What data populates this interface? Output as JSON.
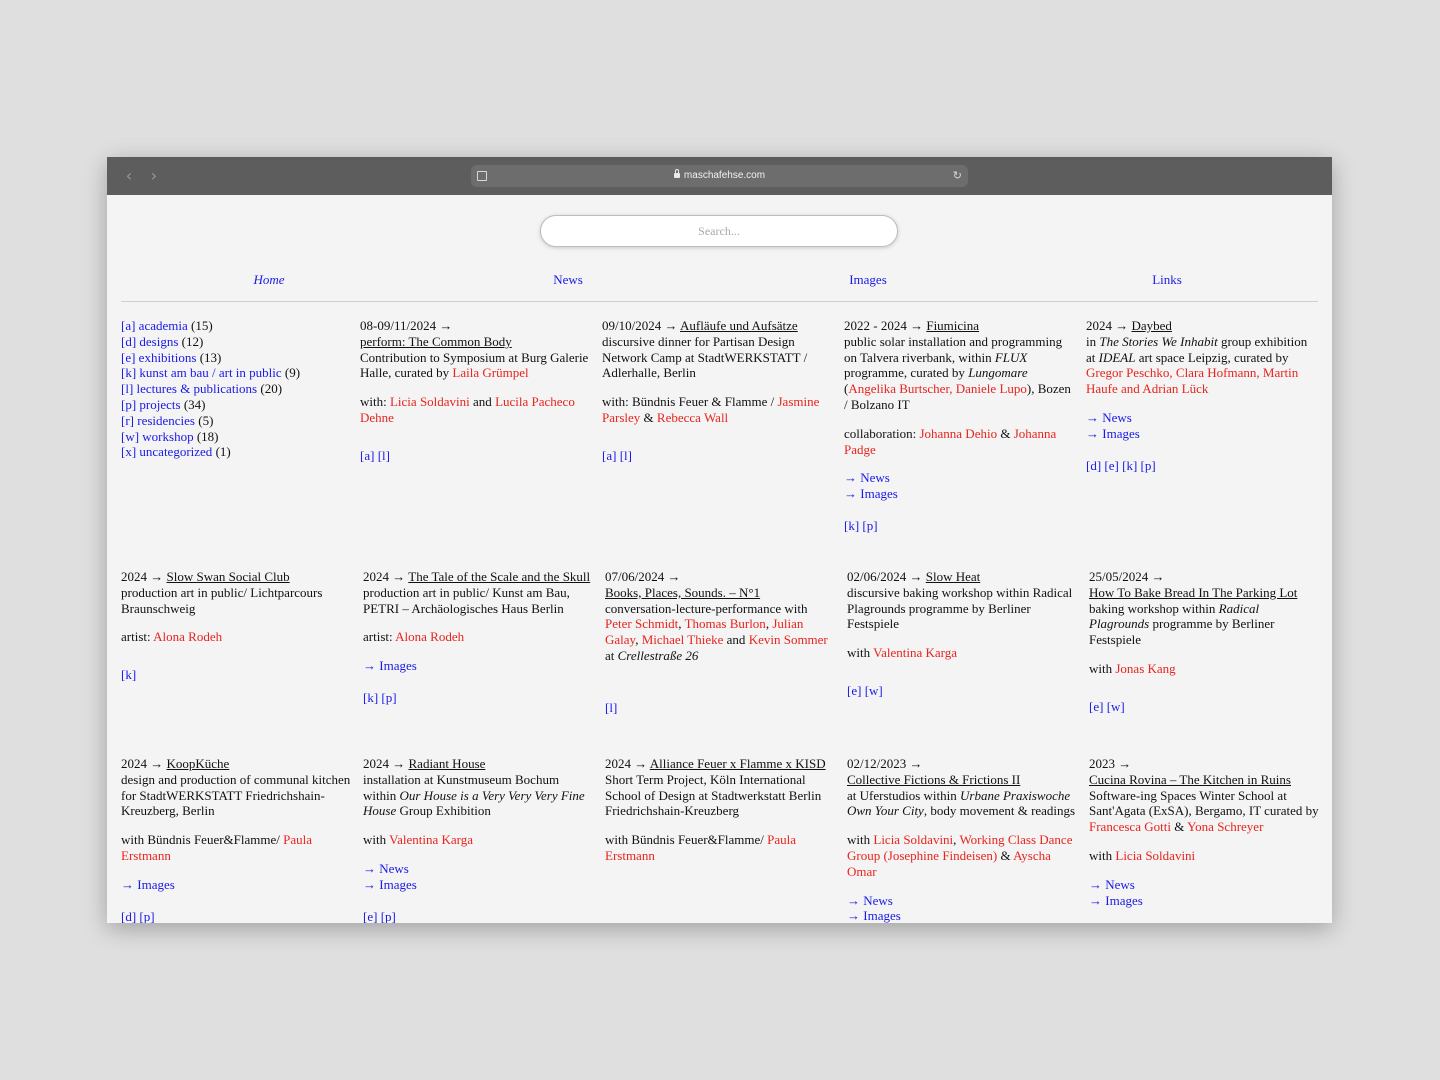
{
  "browser": {
    "url": "maschafehse.com",
    "back_icon": "‹",
    "forward_icon": "›"
  },
  "search": {
    "placeholder": "Search..."
  },
  "nav": {
    "home": "Home",
    "news": "News",
    "images": "Images",
    "links": "Links"
  },
  "categories": [
    {
      "label": "[a] academia",
      "count": "(15)"
    },
    {
      "label": "[d] designs",
      "count": "(12)"
    },
    {
      "label": "[e] exhibitions",
      "count": "(13)"
    },
    {
      "label": "[k] kunst am bau / art in public",
      "count": "(9)"
    },
    {
      "label": "[l] lectures & publications",
      "count": "(20)"
    },
    {
      "label": "[p] projects",
      "count": "(34)"
    },
    {
      "label": "[r] residencies",
      "count": "(5)"
    },
    {
      "label": "[w] workshop",
      "count": "(18)"
    },
    {
      "label": "[x] uncategorized",
      "count": "(1)"
    }
  ],
  "entries": {
    "e1": {
      "date": "08-09/11/2024 →",
      "title": "perform: The Common Body",
      "desc": "Contribution to Symposium at Burg Galerie Halle, curated by ",
      "curator": "Laila Grümpel",
      "with": "with: ",
      "p1": "Licia Soldavini",
      "and": " and ",
      "p2": "Lucila Pacheco Dehne",
      "tags": [
        "[a]",
        "[l]"
      ]
    },
    "e2": {
      "date": "09/10/2024 → ",
      "title": "Aufläufe und Aufsätze",
      "desc": "discursive dinner for Partisan Design Network Camp at StadtWERKSTATT / Adlerhalle, Berlin",
      "with": "with: Bündnis Feuer & Flamme / ",
      "p1": "Jasmine Parsley",
      "amp": " & ",
      "p2": "Rebecca Wall",
      "tags": [
        "[a]",
        "[l]"
      ]
    },
    "e3": {
      "date": "2022 - 2024 → ",
      "title": "Fiumicina",
      "desc1": "public solar installation and programming on Talvera riverbank, within ",
      "flux": "FLUX",
      "desc2": " programme, curated by ",
      "lung": "Lungomare",
      "paren_open": " (",
      "c1": "Angelika Burtscher",
      "comma": ", ",
      "c2": "Daniele Lupo",
      "desc3": "), Bozen / Bolzano IT",
      "collab": "collaboration: ",
      "p1": "Johanna Dehio",
      "amp": " & ",
      "p2": "Johanna Padge",
      "news": "→ News",
      "images": "→ Images",
      "tags": [
        "[k]",
        "[p]"
      ]
    },
    "e4": {
      "date": "2024 → ",
      "title": "Daybed",
      "in": "in ",
      "stories": "The Stories We Inhabit",
      "desc1": " group exhibition at ",
      "ideal": "IDEAL",
      "desc2": " art space Leipzig, curated by ",
      "curators": "Gregor Peschko, Clara Hofmann, Martin Haufe and Adrian Lück",
      "news": "→ News",
      "images": "→ Images",
      "tags": [
        "[d]",
        "[e]",
        "[k]",
        "[p]"
      ]
    },
    "e5": {
      "date": "2024 → ",
      "title": "Slow Swan Social Club",
      "desc": "production art in public/ Lichtparcours Braunschweig",
      "artist": "artist: ",
      "name": "Alona Rodeh",
      "tags": [
        "[k]"
      ]
    },
    "e6": {
      "date": "2024 → ",
      "title": "The Tale of the Scale and the Skull",
      "desc": "production art in public/ Kunst am Bau, PETRI – Archäologisches Haus Berlin",
      "artist": "artist: ",
      "name": "Alona Rodeh",
      "images": "→ Images",
      "tags": [
        "[k]",
        "[p]"
      ]
    },
    "e7": {
      "date": "07/06/2024 →",
      "title": "Books, Places, Sounds. – N°1",
      "desc": "conversation-lecture-performance with ",
      "p1": "Peter Schmidt",
      "c": ", ",
      "p2": "Thomas Burlon",
      "p3": "Julian Galay",
      "p4": "Michael Thieke",
      "and": " and ",
      "p5": "Kevin Sommer",
      "at": "at ",
      "place": "Crellestraße 26",
      "tags": [
        "[l]"
      ]
    },
    "e8": {
      "date": "02/06/2024 → ",
      "title": "Slow Heat",
      "desc": "discursive baking workshop within Radical Plagrounds programme by Berliner Festspiele",
      "with": "with ",
      "name": "Valentina Karga",
      "tags": [
        "[e]",
        "[w]"
      ]
    },
    "e9": {
      "date": "25/05/2024 →",
      "title": "How To Bake Bread In The Parking Lot",
      "desc1": "baking workshop within ",
      "radical": "Radical Plagrounds",
      "desc2": " programme by Berliner Festspiele",
      "with": "with ",
      "name": "Jonas Kang",
      "tags": [
        "[e]",
        "[w]"
      ]
    },
    "e10": {
      "date": "2024 → ",
      "title": "KoopKüche",
      "desc": "design and production of communal kitchen for StadtWERKSTATT Friedrichshain-Kreuzberg, Berlin",
      "with": "with Bündnis Feuer&Flamme/ ",
      "name": "Paula Erstmann",
      "images": "→ Images",
      "tags": [
        "[d]",
        "[p]"
      ]
    },
    "e11": {
      "date": "2024 → ",
      "title": "Radiant House",
      "desc1": "installation at Kunstmuseum Bochum within ",
      "house": "Our House is a Very Very Very Fine House",
      "desc2": " Group Exhibition",
      "with": "with ",
      "name": "Valentina Karga",
      "news": "→ News",
      "images": "→ Images",
      "tags": [
        "[e]",
        "[p]"
      ]
    },
    "e12": {
      "date": "2024 → ",
      "title": "Alliance Feuer x Flamme x KISD",
      "desc": "Short Term Project, Köln International School of Design at Stadtwerkstatt Berlin Friedrichshain-Kreuzberg",
      "with": "with Bündnis Feuer&Flamme/ ",
      "name": "Paula Erstmann"
    },
    "e13": {
      "date": "02/12/2023 →",
      "title": "Collective Fictions & Frictions II",
      "desc1": "at Uferstudios within ",
      "urbane": "Urbane Praxiswoche Own Your City",
      "desc2": ", body movement & readings",
      "with": "with ",
      "p1": "Licia Soldavini",
      "c": ", ",
      "p2": "Working Class Dance Group (Josephine Findeisen)",
      "amp": " & ",
      "p3": "Ayscha Omar",
      "news": "→ News",
      "images": "→ Images"
    },
    "e14": {
      "date": "2023 →",
      "title": "Cucina Rovina – The Kitchen in Ruins",
      "desc": "Software-ing Spaces Winter School at Sant'Agata (ExSA), Bergamo, IT curated by ",
      "c1": "Francesca Gotti",
      "amp": " & ",
      "c2": "Yona Schreyer",
      "with": "with ",
      "name": "Licia Soldavini",
      "news": "→ News",
      "images": "→ Images"
    }
  }
}
